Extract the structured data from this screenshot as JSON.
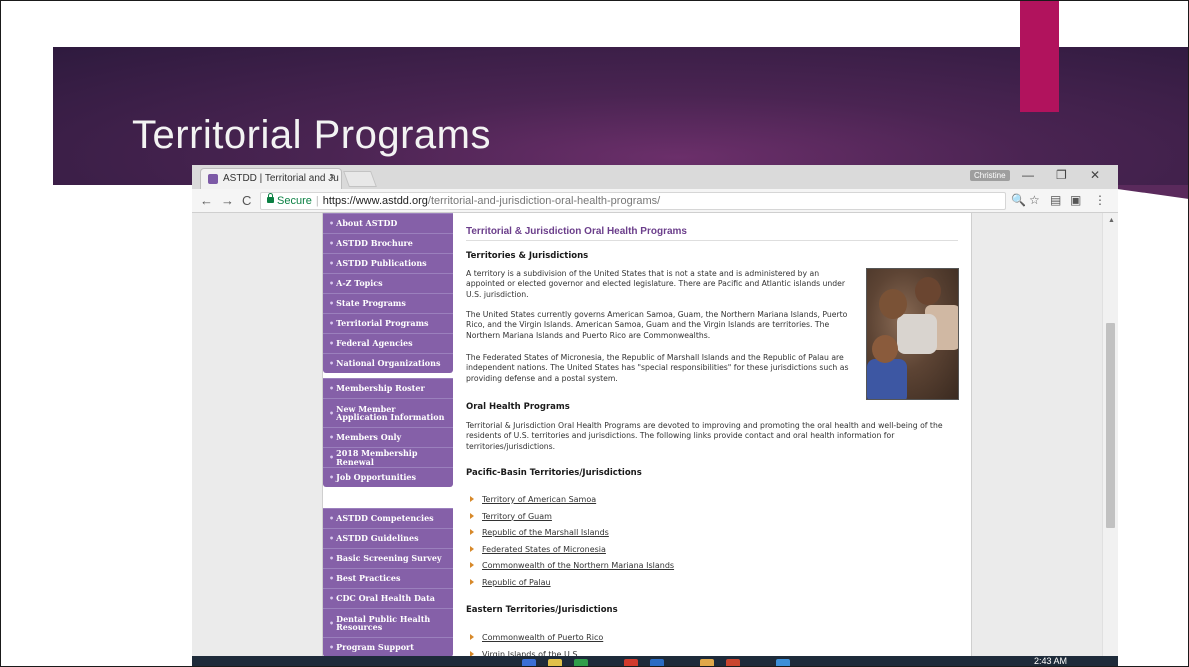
{
  "slide": {
    "title": "Territorial Programs",
    "colors": {
      "banner": "#4a2452",
      "accent": "#b1135d"
    }
  },
  "browser": {
    "tab_title": "ASTDD | Territorial and Ju",
    "tab_close": "×",
    "profile_name": "Christine",
    "window_controls": {
      "minimize": "—",
      "restore": "❐",
      "close": "✕"
    },
    "nav": {
      "back": "←",
      "forward": "→",
      "reload": "C"
    },
    "security_label": "Secure",
    "separator": "|",
    "url_host": "https://www.astdd.org",
    "url_path": "/territorial-and-jurisdiction-oral-health-programs/",
    "tools": {
      "zoom": "🔍",
      "bookmark": "☆",
      "ext1": "▤",
      "ext2": "▣",
      "menu": "⋮"
    }
  },
  "sidebar": {
    "group1": [
      "About ASTDD",
      "ASTDD Brochure",
      "ASTDD Publications",
      "A-Z Topics",
      "State Programs",
      "Territorial Programs",
      "Federal Agencies",
      "National Organizations"
    ],
    "group2": [
      "Membership Roster",
      "New Member Application Information",
      "Members Only",
      "2018 Membership Renewal",
      "Job Opportunities"
    ],
    "group3": [
      "ASTDD Competencies",
      "ASTDD Guidelines",
      "Basic Screening Survey",
      "Best Practices",
      "CDC Oral Health Data",
      "Dental Public Health Resources",
      "Program Support"
    ],
    "bullet": "•"
  },
  "content": {
    "heading": "Territorial & Jurisdiction Oral Health Programs",
    "territories_heading": "Territories & Jurisdictions",
    "para1": "A territory is a subdivision of the United States that is not a state and is administered by an appointed or elected governor and elected legislature. There are Pacific and Atlantic islands under U.S. jurisdiction.",
    "para2": "The United States currently governs American Samoa, Guam, the Northern Mariana Islands, Puerto Rico, and the Virgin Islands. American Samoa, Guam and the Virgin Islands are territories. The Northern Mariana Islands and Puerto Rico are Commonwealths.",
    "para3": "The Federated States of Micronesia, the Republic of Marshall Islands and the Republic of Palau are independent nations. The United States has \"special responsibilities\" for these jurisdictions such as providing defense and a postal system.",
    "oral_heading": "Oral Health Programs",
    "para4": "Territorial & Jurisdiction Oral Health Programs are devoted to improving and promoting the oral health and well-being of the residents of U.S. territories and jurisdictions. The following links provide contact and oral health information for territories/jurisdictions.",
    "pacific_heading": "Pacific-Basin Territories/Jurisdictions",
    "pacific_links": [
      "Territory of American Samoa",
      "Territory of Guam",
      "Republic of the Marshall Islands",
      "Federated States of Micronesia",
      "Commonwealth of the Northern Mariana Islands",
      "Republic of Palau"
    ],
    "eastern_heading": "Eastern Territories/Jurisdictions",
    "eastern_links": [
      "Commonwealth of Puerto Rico",
      "Virgin Islands of the U.S."
    ]
  },
  "scrollbar": {
    "up": "▲",
    "down": "▼"
  },
  "taskbar": {
    "time": "2:43 AM"
  }
}
